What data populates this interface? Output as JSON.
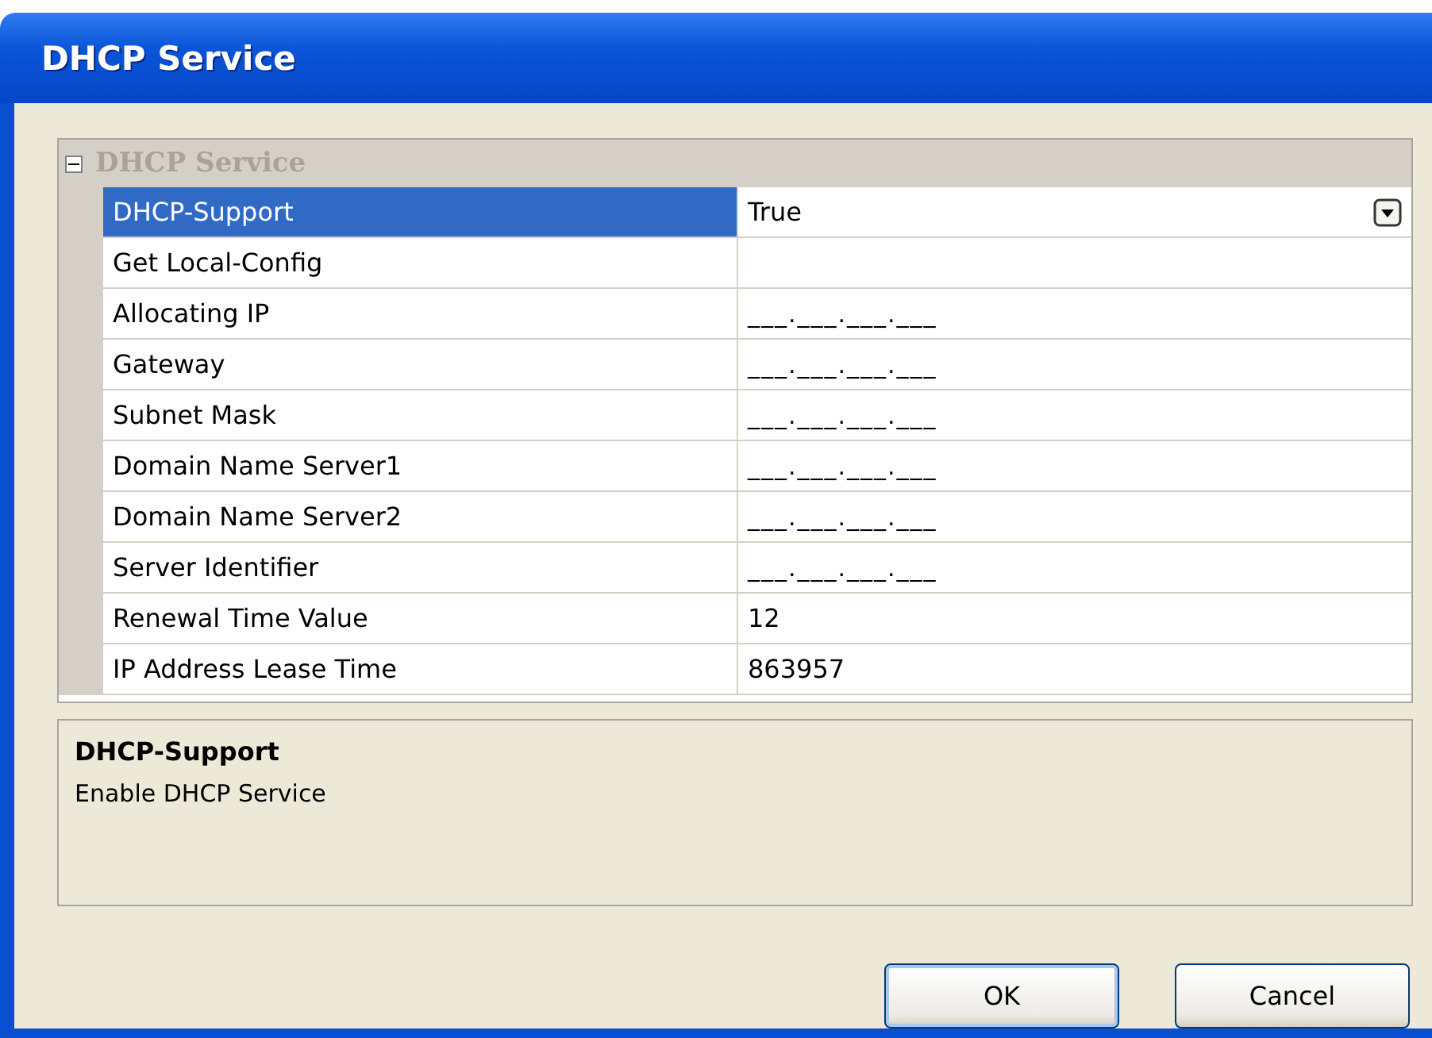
{
  "window": {
    "title": "DHCP Service"
  },
  "property_grid": {
    "group": {
      "label": "DHCP Service",
      "expanded": true
    },
    "rows": [
      {
        "name": "DHCP-Support",
        "value": "True",
        "selected": true,
        "kind": "dropdown"
      },
      {
        "name": "Get Local-Config",
        "value": "",
        "selected": false,
        "kind": "text"
      },
      {
        "name": "Allocating IP",
        "value": "___.___.___.___",
        "selected": false,
        "kind": "ip"
      },
      {
        "name": "Gateway",
        "value": "___.___.___.___",
        "selected": false,
        "kind": "ip"
      },
      {
        "name": "Subnet Mask",
        "value": "___.___.___.___",
        "selected": false,
        "kind": "ip"
      },
      {
        "name": "Domain Name Server1",
        "value": "___.___.___.___",
        "selected": false,
        "kind": "ip"
      },
      {
        "name": "Domain Name Server2",
        "value": "___.___.___.___",
        "selected": false,
        "kind": "ip"
      },
      {
        "name": "Server Identifier",
        "value": "___.___.___.___",
        "selected": false,
        "kind": "ip"
      },
      {
        "name": "Renewal Time Value",
        "value": "12",
        "selected": false,
        "kind": "text"
      },
      {
        "name": "IP Address Lease Time",
        "value": "863957",
        "selected": false,
        "kind": "text"
      }
    ]
  },
  "description": {
    "title": "DHCP-Support",
    "text": "Enable DHCP Service"
  },
  "buttons": [
    {
      "label": "OK",
      "default": true
    },
    {
      "label": "Cancel",
      "default": false
    }
  ]
}
